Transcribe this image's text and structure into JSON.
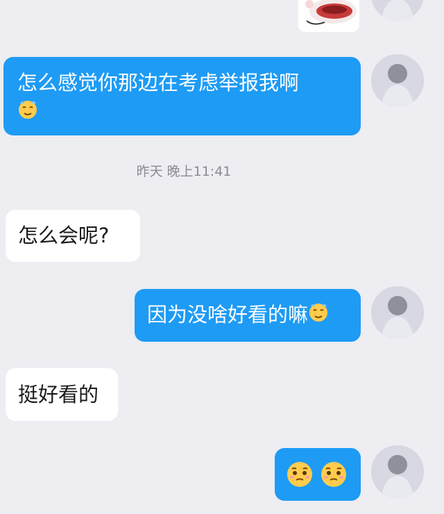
{
  "conversation": {
    "messages": [
      {
        "id": "m1",
        "side": "out",
        "kind": "sticker",
        "sticker": "cat-sticker"
      },
      {
        "id": "m2",
        "side": "out",
        "text": "怎么感觉你那边在考虑举报我啊",
        "trailing_emoji": "sweat-smile-emoji"
      },
      {
        "id": "m3",
        "side": "in",
        "text": "怎么会呢?"
      },
      {
        "id": "m4",
        "side": "out",
        "text": "因为没啥好看的嘛",
        "trailing_emoji": "sweat-smile-emoji"
      },
      {
        "id": "m5",
        "side": "in",
        "text": "挺好看的"
      },
      {
        "id": "m6",
        "side": "out",
        "kind": "emoji-only",
        "emojis": [
          "pleading-emoji",
          "pleading-emoji"
        ]
      }
    ],
    "timestamp": "昨天 晚上11:41"
  },
  "colors": {
    "background": "#ededf2",
    "outgoing_bubble": "#1e9bf5",
    "incoming_bubble": "#ffffff",
    "timestamp_text": "#8a8a92"
  }
}
